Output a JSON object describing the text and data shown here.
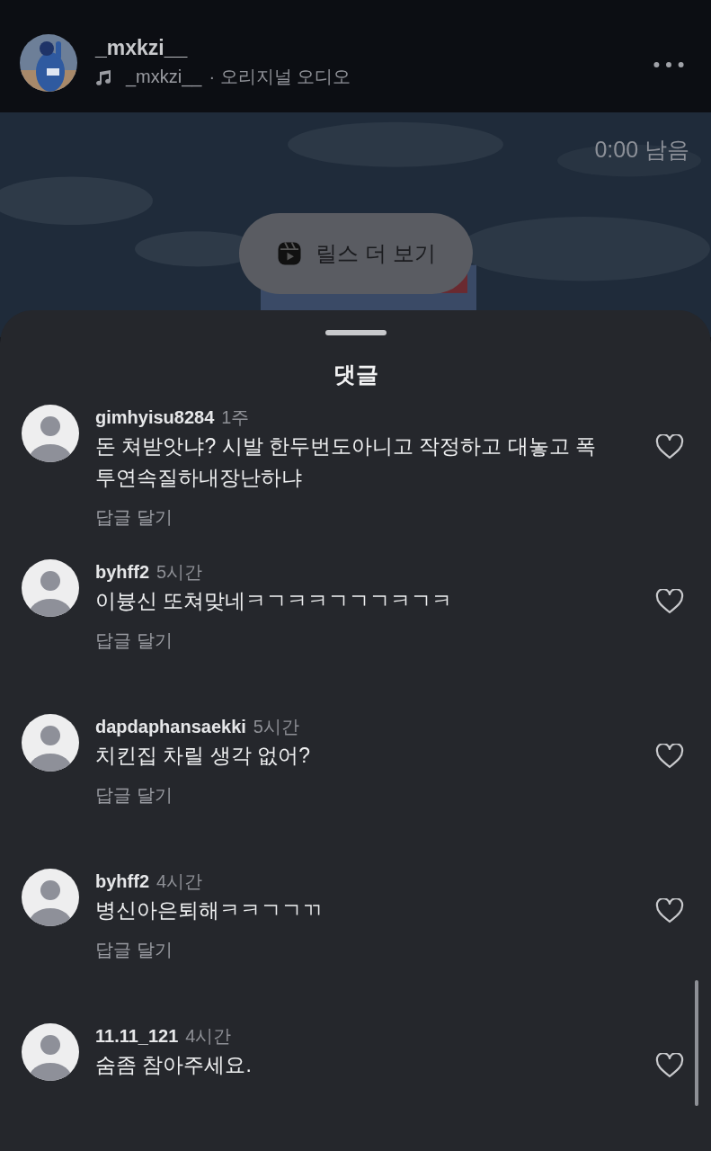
{
  "header": {
    "username": "_mxkzi__",
    "audio_owner": "_mxkzi__",
    "audio_label": "· 오리지널 오디오"
  },
  "video": {
    "kind": "picture",
    "time_left": "0:00 남음",
    "reels_button": "릴스 더 보기"
  },
  "comments_sheet": {
    "title": "댓글",
    "comments": [
      {
        "username": "gimhyisu8284",
        "time": "1주",
        "text": "돈 쳐받앗냐? 시발 한두번도아니고 작정하고 대놓고 폭투연속질하내장난하냐",
        "reply": "답글 달기",
        "liked": false
      },
      {
        "username": "byhff2",
        "time": "5시간",
        "text": "이븅신 또쳐맞네ㅋㄱㅋㅋㄱㄱㄱㅋㄱㅋ",
        "reply": "답글 달기",
        "liked": false
      },
      {
        "username": "dapdaphansaekki",
        "time": "5시간",
        "text": "치킨집 차릴 생각 없어?",
        "reply": "답글 달기",
        "liked": false
      },
      {
        "username": "byhff2",
        "time": "4시간",
        "text": "병신아은퇴해ㅋㅋㄱㄱㄲ",
        "reply": "답글 달기",
        "liked": false
      },
      {
        "username": "11.11_121",
        "time": "4시간",
        "text": "숨좀 참아주세요.",
        "liked": false
      }
    ]
  }
}
